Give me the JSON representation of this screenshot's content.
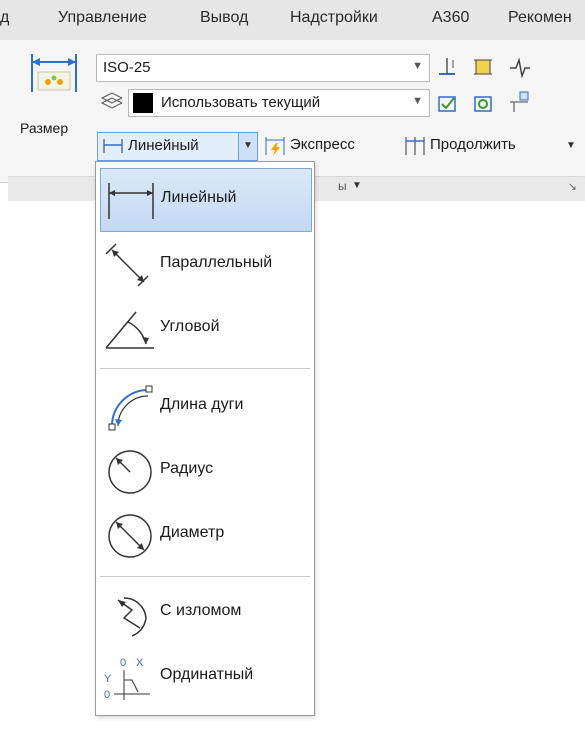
{
  "menubar": {
    "tabs": [
      "д",
      "Управление",
      "Вывод",
      "Надстройки",
      "A360",
      "Рекомен"
    ]
  },
  "ribbon": {
    "dimension_button": "Размер",
    "dim_style": "ISO-25",
    "layer": "Использовать текущий",
    "linear_split": "Линейный",
    "express": "Экспресс",
    "continue": "Продолжить",
    "panel_label": "ы"
  },
  "dropdown": {
    "items": [
      {
        "label": "Линейный",
        "icon": "linear-dim-icon"
      },
      {
        "label": "Параллельный",
        "icon": "aligned-dim-icon"
      },
      {
        "label": "Угловой",
        "icon": "angular-dim-icon"
      },
      {
        "label": "Длина дуги",
        "icon": "arc-length-icon"
      },
      {
        "label": "Радиус",
        "icon": "radius-icon"
      },
      {
        "label": "Диаметр",
        "icon": "diameter-icon"
      },
      {
        "label": "С изломом",
        "icon": "jogged-icon"
      },
      {
        "label": "Ординатный",
        "icon": "ordinate-icon"
      }
    ],
    "ordinate_glyph": {
      "x": "X",
      "y": "Y",
      "zero": "0"
    }
  },
  "colors": {
    "accent": "#2f6fc8",
    "selection": "#c3d9f2",
    "brand_orange": "#f2a200"
  }
}
